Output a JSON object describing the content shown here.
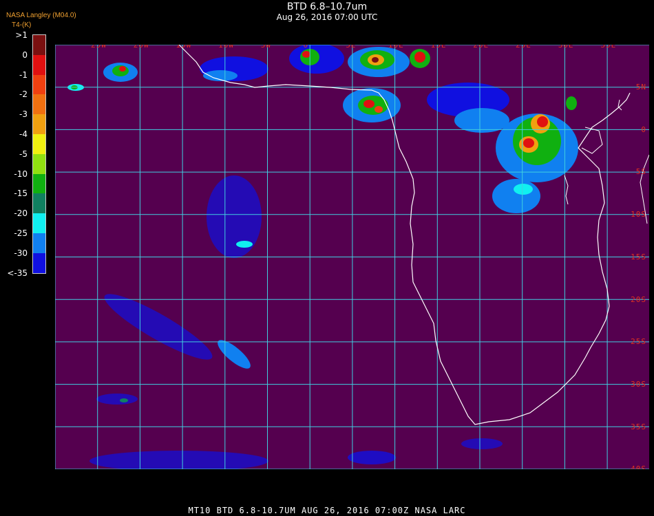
{
  "header": {
    "title": "BTD 6.8–10.7um",
    "datetime": "Aug 26, 2016 07:00 UTC",
    "credit": "NASA Langley (M04.0)",
    "units": "T4-(K)"
  },
  "legend": {
    "labels": [
      ">1",
      "0",
      "-1",
      "-2",
      "-3",
      "-4",
      "-5",
      "-10",
      "-15",
      "-20",
      "-25",
      "-30",
      "<-35"
    ],
    "colors": [
      "#7a1010",
      "#e01010",
      "#f04010",
      "#f07010",
      "#f0a010",
      "#f0f010",
      "#90e010",
      "#10b010",
      "#108060",
      "#10f0f0",
      "#1080f0",
      "#1010e0",
      "#55004f"
    ]
  },
  "map": {
    "background": "#55004f",
    "grid_color": "#40d0e0",
    "coast_color": "#ffffff",
    "lon_labels": [
      "25W",
      "20W",
      "15W",
      "10W",
      "5W",
      "0",
      "5E",
      "10E",
      "15E",
      "20E",
      "25E",
      "30E",
      "35E"
    ],
    "lat_labels": [
      "5N",
      "0",
      "5S",
      "10S",
      "15S",
      "20S",
      "25S",
      "30S",
      "35S",
      "40S"
    ]
  },
  "footer": "MT10  BTD 6.8-10.7UM   AUG 26, 2016 07:00Z   NASA LARC"
}
